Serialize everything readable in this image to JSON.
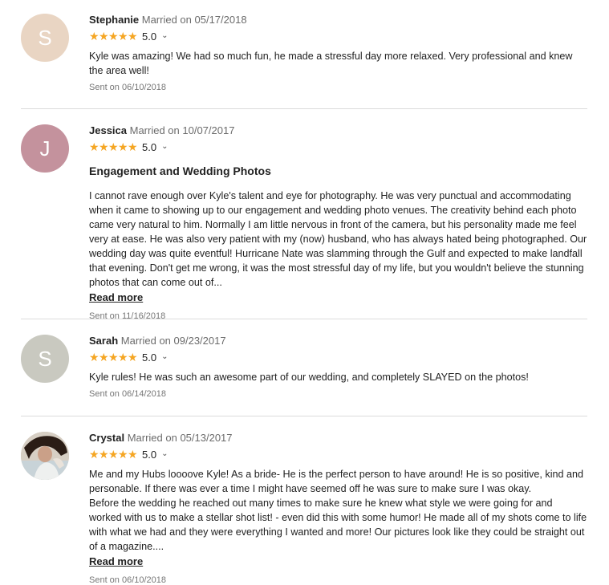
{
  "reviews": [
    {
      "initial": "S",
      "avatar_color": "#e9d5c3",
      "name": "Stephanie",
      "married": "Married on 05/17/2018",
      "score": "5.0",
      "title": "",
      "body": "Kyle was amazing! We had so much fun, he made a stressful day more relaxed. Very professional and knew the area well!",
      "read_more": "",
      "sent": "Sent on 06/10/2018"
    },
    {
      "initial": "J",
      "avatar_color": "#c4929d",
      "name": "Jessica",
      "married": "Married on 10/07/2017",
      "score": "5.0",
      "title": "Engagement and Wedding Photos",
      "body": "I cannot rave enough over Kyle's talent and eye for photography. He was very punctual and accommodating when it came to showing up to our engagement and wedding photo venues. The creativity behind each photo came very natural to him. Normally I am little nervous in front of the camera, but his personality made me feel very at ease. He was also very patient with my (now) husband, who has always hated being photographed. Our wedding day was quite eventful! Hurricane Nate was slamming through the Gulf and expected to make landfall that evening. Don't get me wrong, it was the most stressful day of my life, but you wouldn't believe the stunning photos that can come out of...",
      "read_more": "Read more",
      "sent": "Sent on 11/16/2018"
    },
    {
      "initial": "S",
      "avatar_color": "#c9c9c0",
      "name": "Sarah",
      "married": "Married on 09/23/2017",
      "score": "5.0",
      "title": "",
      "body": "Kyle rules! He was such an awesome part of our wedding, and completely SLAYED on the photos!",
      "read_more": "",
      "sent": "Sent on 06/14/2018"
    },
    {
      "initial": "",
      "avatar_color": "#cfc6bb",
      "name": "Crystal",
      "married": "Married on 05/13/2017",
      "score": "5.0",
      "title": "",
      "body": "Me and my Hubs loooove Kyle! As a bride- He is the perfect person to have around! He is so positive, kind and personable. If there was ever a time I might have seemed off he was sure to make sure I was okay.\nBefore the wedding he reached out many times to make sure he knew what style we were going for and worked with us to make a stellar shot list! - even did this with some humor! He made all of my shots come to life with what we had and they were everything I wanted and more! Our pictures look like they could be straight out of a magazine....",
      "read_more": "Read more",
      "sent": "Sent on 06/10/2018"
    }
  ],
  "star_color": "#f5a623"
}
